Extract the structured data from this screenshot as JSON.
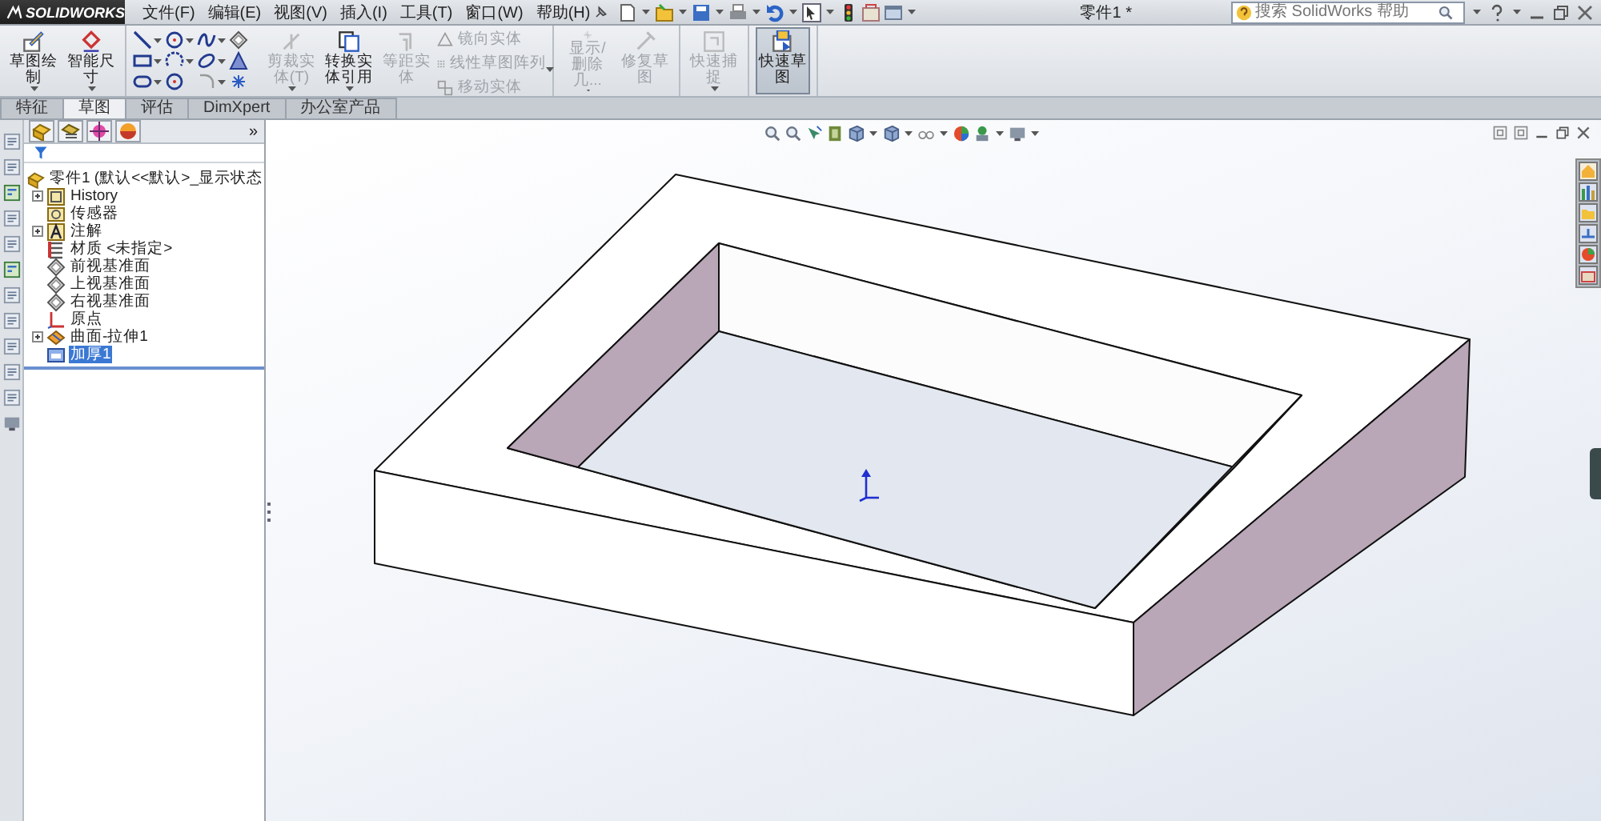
{
  "app": {
    "brand": "SOLIDWORKS"
  },
  "menu": [
    "文件(F)",
    "编辑(E)",
    "视图(V)",
    "插入(I)",
    "工具(T)",
    "窗口(W)",
    "帮助(H)"
  ],
  "document_title": "零件1 *",
  "search": {
    "placeholder": "搜索 SolidWorks 帮助"
  },
  "ribbon": {
    "groups": [
      [
        {
          "kind": "large",
          "label": "草图绘制",
          "disabled": false,
          "selected": false,
          "dropdown": true
        },
        {
          "kind": "large",
          "label": "智能尺寸",
          "disabled": false,
          "selected": false,
          "dropdown": true
        }
      ],
      [
        {
          "kind": "grid",
          "tools": [
            {
              "dropdown": true
            },
            {
              "dropdown": true
            },
            {
              "dropdown": true
            },
            {
              "dropdown": false
            },
            {
              "dropdown": true
            },
            {
              "dropdown": true
            },
            {
              "dropdown": true
            },
            {
              "dropdown": false
            },
            {
              "dropdown": true
            },
            {
              "dropdown": false
            },
            {
              "dropdown": true
            },
            {
              "dropdown": false
            }
          ]
        },
        {
          "kind": "large",
          "label": "剪裁实体(T)",
          "disabled": true,
          "selected": false,
          "dropdown": true
        },
        {
          "kind": "large",
          "label": "转换实体引用",
          "disabled": false,
          "selected": false,
          "dropdown": true
        },
        {
          "kind": "large",
          "label": "等距实体",
          "disabled": true,
          "selected": false,
          "dropdown": false
        },
        {
          "kind": "stack",
          "dropdown": true,
          "items": [
            {
              "label": "镜向实体",
              "disabled": true
            },
            {
              "label": "线性草图阵列",
              "disabled": true
            },
            {
              "label": "移动实体",
              "disabled": true
            }
          ]
        }
      ],
      [
        {
          "kind": "large",
          "label": "显示/删除几...",
          "disabled": true,
          "selected": false,
          "dropdown": true
        },
        {
          "kind": "large",
          "label": "修复草图",
          "disabled": true,
          "selected": false,
          "dropdown": false
        }
      ],
      [
        {
          "kind": "large",
          "label": "快速捕捉",
          "disabled": true,
          "selected": false,
          "dropdown": true
        }
      ],
      [
        {
          "kind": "large",
          "label": "快速草图",
          "disabled": false,
          "selected": true,
          "dropdown": false
        }
      ]
    ]
  },
  "tabs": [
    {
      "label": "特征",
      "selected": false
    },
    {
      "label": "草图",
      "selected": true
    },
    {
      "label": "评估",
      "selected": false
    },
    {
      "label": "DimXpert",
      "selected": false
    },
    {
      "label": "办公室产品",
      "selected": false
    }
  ],
  "feature_tree": {
    "more": "»",
    "root": "零件1 (默认<<默认>_显示状态",
    "items": [
      {
        "label": "History",
        "collapsed": true,
        "selected": false
      },
      {
        "label": "传感器",
        "collapsed": false,
        "selected": false
      },
      {
        "label": "注解",
        "collapsed": true,
        "selected": false
      },
      {
        "label": "材质 <未指定>",
        "collapsed": false,
        "selected": false
      },
      {
        "label": "前视基准面",
        "collapsed": false,
        "selected": false
      },
      {
        "label": "上视基准面",
        "collapsed": false,
        "selected": false
      },
      {
        "label": "右视基准面",
        "collapsed": false,
        "selected": false
      },
      {
        "label": "原点",
        "collapsed": false,
        "selected": false
      },
      {
        "label": "曲面-拉伸1",
        "collapsed": true,
        "selected": false
      },
      {
        "label": "加厚1",
        "collapsed": false,
        "selected": true
      }
    ]
  }
}
